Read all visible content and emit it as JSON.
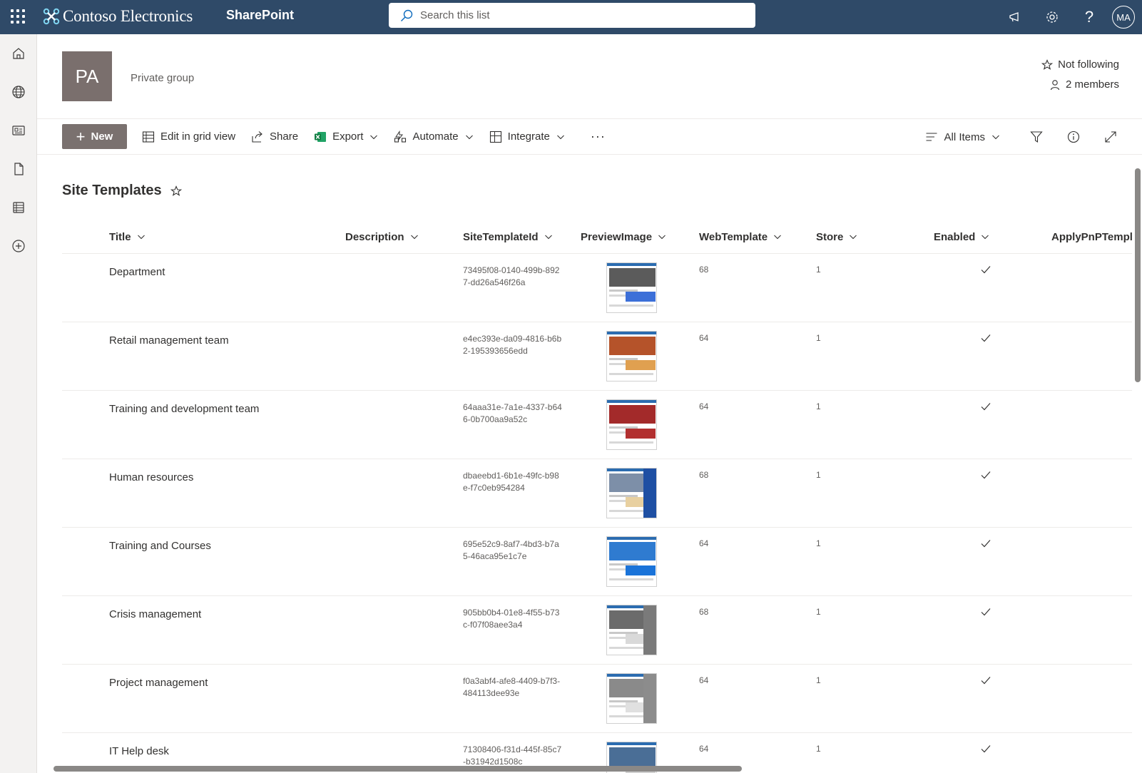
{
  "suite": {
    "brand": "Contoso Electronics",
    "app": "SharePoint",
    "search_placeholder": "Search this list",
    "avatar_initials": "MA"
  },
  "site": {
    "logo_initials": "PA",
    "privacy": "Private group",
    "follow_label": "Not following",
    "members_label": "2 members"
  },
  "commands": {
    "new": "New",
    "edit_grid": "Edit in grid view",
    "share": "Share",
    "export": "Export",
    "automate": "Automate",
    "integrate": "Integrate",
    "more": "···",
    "view": "All Items"
  },
  "list": {
    "title": "Site Templates",
    "columns": [
      "Title",
      "Description",
      "SiteTemplateId",
      "PreviewImage",
      "WebTemplate",
      "Store",
      "Enabled",
      "ApplyPnPTempl..."
    ],
    "rows": [
      {
        "title": "Department",
        "id": "73495f08-0140-499b-8927-dd26a546f26a",
        "web": "68",
        "store": "1",
        "hero": "#5b5b5b",
        "blk": "#3c6fd8",
        "side": ""
      },
      {
        "title": "Retail management team",
        "id": "e4ec393e-da09-4816-b6b2-195393656edd",
        "web": "64",
        "store": "1",
        "hero": "#b5532a",
        "blk": "#e0a050",
        "side": ""
      },
      {
        "title": "Training and development team",
        "id": "64aaa31e-7a1e-4337-b646-0b700aa9a52c",
        "web": "64",
        "store": "1",
        "hero": "#a32a2a",
        "blk": "#b23030",
        "side": ""
      },
      {
        "title": "Human resources",
        "id": "dbaeebd1-6b1e-49fc-b98e-f7c0eb954284",
        "web": "68",
        "store": "1",
        "hero": "#7d8fa8",
        "blk": "#e8d0a0",
        "side": "#1e4fa3"
      },
      {
        "title": "Training and Courses",
        "id": "695e52c9-8af7-4bd3-b7a5-46aca95e1c7e",
        "web": "64",
        "store": "1",
        "hero": "#2f7bd0",
        "blk": "#1a73d9",
        "side": ""
      },
      {
        "title": "Crisis management",
        "id": "905bb0b4-01e8-4f55-b73c-f07f08aee3a4",
        "web": "68",
        "store": "1",
        "hero": "#6b6b6b",
        "blk": "#d9d9d9",
        "side": "#7a7a7a"
      },
      {
        "title": "Project management",
        "id": "f0a3abf4-afe8-4409-b7f3-484113dee93e",
        "web": "64",
        "store": "1",
        "hero": "#8a8a8a",
        "blk": "#e0e0e0",
        "side": "#8c8c8c"
      },
      {
        "title": "IT Help desk",
        "id": "71308406-f31d-445f-85c7-b31942d1508c",
        "web": "64",
        "store": "1",
        "hero": "#4a6e96",
        "blk": "#d0d0d0",
        "side": ""
      }
    ]
  }
}
